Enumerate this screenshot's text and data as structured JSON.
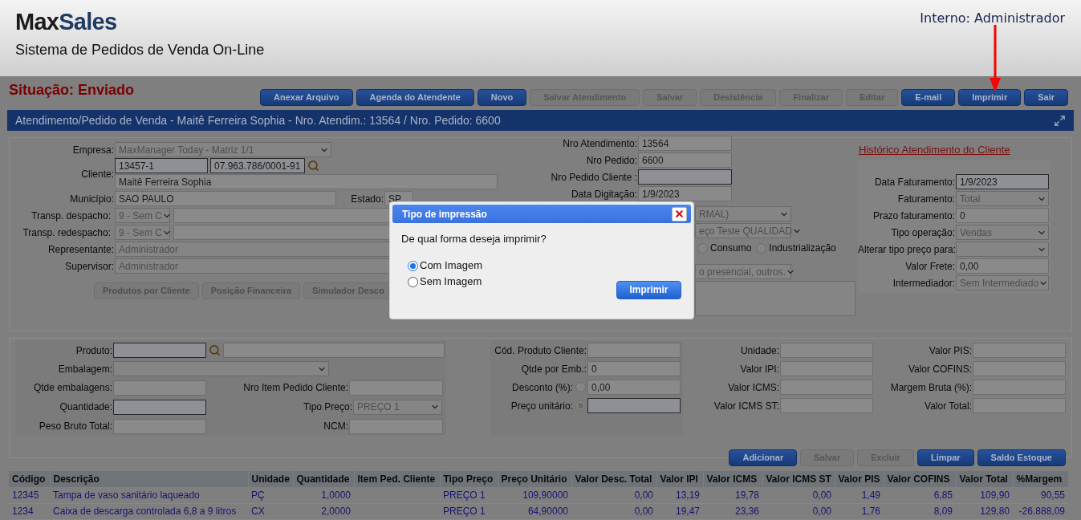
{
  "header": {
    "brand_first": "Max",
    "brand_second": "Sales",
    "subtitle": "Sistema de Pedidos de Venda On-Line",
    "user": "Interno: Administrador"
  },
  "status": {
    "label": "Situação:",
    "value": "Enviado"
  },
  "toolbar": [
    {
      "label": "Anexar Arquivo",
      "disabled": false
    },
    {
      "label": "Agenda do Atendente",
      "disabled": false
    },
    {
      "label": "Novo",
      "disabled": false
    },
    {
      "label": "Salvar Atendimento",
      "disabled": true
    },
    {
      "label": "Salvar",
      "disabled": true
    },
    {
      "label": "Desistência",
      "disabled": true
    },
    {
      "label": "Finalizar",
      "disabled": true
    },
    {
      "label": "Editar",
      "disabled": true
    },
    {
      "label": "E-mail",
      "disabled": false
    },
    {
      "label": "Imprimir",
      "disabled": false
    },
    {
      "label": "Sair",
      "disabled": false
    }
  ],
  "panel_title": "Atendimento/Pedido de Venda - Maitê Ferreira Sophia - Nro. Atendim.: 13564 / Nro. Pedido: 6600",
  "client": {
    "empresa": {
      "label": "Empresa:",
      "value": "MaxManager Today - Matriz 1/1"
    },
    "cliente": {
      "label": "Cliente:",
      "code": "13457-1",
      "document": "07.963.786/0001-91",
      "name": "Maitê Ferreira Sophia"
    },
    "municipio": {
      "label": "Município:",
      "value": "SAO PAULO"
    },
    "estado": {
      "label": "Estado:",
      "value": "SP"
    },
    "transp_despacho": {
      "label": "Transp. despacho:",
      "value": "9 - Sem C"
    },
    "transp_redespacho": {
      "label": "Transp. redespacho:",
      "value": "9 - Sem C"
    },
    "representante": {
      "label": "Representante:",
      "value": "Administrador"
    },
    "supervisor": {
      "label": "Supervisor:",
      "value": "Administrador"
    },
    "buttons": [
      "Produtos por Cliente",
      "Posição Financeira",
      "Simulador Desco"
    ]
  },
  "order": {
    "fields": [
      {
        "label": "Nro Atendimento:",
        "value": "13564",
        "kind": "input"
      },
      {
        "label": "Nro Pedido:",
        "value": "6600",
        "kind": "input"
      },
      {
        "label": "Nro Pedido Cliente :",
        "kind": "input-required"
      },
      {
        "label": "Data Digitação:",
        "value": "1/9/2023",
        "kind": "input"
      }
    ],
    "select_1": "RMAL)",
    "select_2": "eço Teste QUALIDAD",
    "radios": [
      {
        "label": "Consumo",
        "selected": false
      },
      {
        "label": "Industrialização",
        "selected": false
      }
    ],
    "select_3": "o presencial, outros."
  },
  "billing": {
    "link": "Histórico Atendimento do Cliente",
    "fields": [
      {
        "label": "Data Faturamento:",
        "value": "1/9/2023",
        "kind": "input-required"
      },
      {
        "label": "Faturamento:",
        "value": "Total",
        "kind": "select"
      },
      {
        "label": "Prazo faturamento:",
        "value": "0",
        "kind": "input"
      },
      {
        "label": "Tipo operação:",
        "value": "Vendas",
        "kind": "select"
      },
      {
        "label": "Alterar tipo preço para:",
        "kind": "select"
      },
      {
        "label": "Valor Frete:",
        "value": "0,00",
        "kind": "input"
      },
      {
        "label": "Intermediador:",
        "value": "Sem Intermediado",
        "kind": "select"
      }
    ]
  },
  "product": {
    "produto": {
      "label": "Produto:"
    },
    "embalagem": {
      "label": "Embalagem:"
    },
    "qtde_embalagens": {
      "label": "Qtde embalagens:"
    },
    "nro_item": {
      "label": "Nro Item Pedido Cliente:"
    },
    "quantidade": {
      "label": "Quantidade:"
    },
    "tipo_preco": {
      "label": "Tipo Preço:",
      "value": "PREÇO 1"
    },
    "peso": {
      "label": "Peso Bruto Total:"
    },
    "ncm": {
      "label": "NCM:"
    },
    "col2": [
      {
        "label": "Cód. Produto Cliente:",
        "kind": "input"
      },
      {
        "label": "Qtde por Emb.:",
        "value": "0",
        "kind": "input"
      },
      {
        "label": "Desconto (%):",
        "value": "0,00",
        "kind": "radio-input",
        "selected": false
      },
      {
        "label": "Preço unitário:",
        "kind": "radio-input",
        "selected": true
      }
    ],
    "col3": [
      {
        "label": "Unidade:"
      },
      {
        "label": "Valor IPI:"
      },
      {
        "label": "Valor ICMS:"
      },
      {
        "label": "Valor ICMS ST:"
      }
    ],
    "col4": [
      {
        "label": "Valor PIS:"
      },
      {
        "label": "Valor COFINS:"
      },
      {
        "label": "Margem Bruta (%):"
      },
      {
        "label": "Valor Total:"
      }
    ],
    "buttons": [
      {
        "label": "Adicionar",
        "disabled": false
      },
      {
        "label": "Salvar",
        "disabled": true
      },
      {
        "label": "Excluir",
        "disabled": true
      },
      {
        "label": "Limpar",
        "disabled": false
      },
      {
        "label": "Saldo Estoque",
        "disabled": false
      }
    ]
  },
  "table": {
    "columns": [
      "Código",
      "Descrição",
      "Unidade",
      "Quantidade",
      "Item Ped. Cliente",
      "Tipo Preço",
      "Preço Unitário",
      "Valor Desc. Total",
      "Valor IPI",
      "Valor ICMS",
      "Valor ICMS ST",
      "Valor PIS",
      "Valor COFINS",
      "Valor Total",
      "%Margem"
    ],
    "rows": [
      [
        "12345",
        "Tampa de vaso sanitário laqueado",
        "PÇ",
        "1,0000",
        "",
        "PREÇO 1",
        "109,90000",
        "0,00",
        "13,19",
        "19,78",
        "0,00",
        "1,49",
        "6,85",
        "109,90",
        "90,55"
      ],
      [
        "1234",
        "Caixa de descarga controlada 6,8 a 9 litros",
        "CX",
        "2,0000",
        "",
        "PREÇO 1",
        "64,90000",
        "0,00",
        "19,47",
        "23,36",
        "0,00",
        "1,76",
        "8,09",
        "129,80",
        "-26.888,09"
      ]
    ]
  },
  "dialog": {
    "title": "Tipo de impressão",
    "question": "De qual forma deseja imprimir?",
    "options": [
      {
        "label": "Com Imagem",
        "selected": true
      },
      {
        "label": "Sem Imagem",
        "selected": false
      }
    ],
    "button": "Imprimir"
  }
}
